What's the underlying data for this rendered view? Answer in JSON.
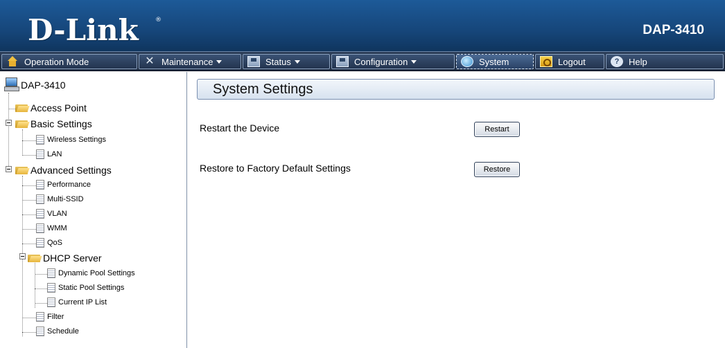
{
  "header": {
    "logo": "D-Link",
    "logo_mark": "®",
    "model": "DAP-3410"
  },
  "menu": [
    {
      "label": "Operation Mode",
      "icon": "home-icon",
      "dropdown": false
    },
    {
      "label": "Maintenance",
      "icon": "tools-icon",
      "dropdown": true
    },
    {
      "label": "Status",
      "icon": "disk-icon",
      "dropdown": true
    },
    {
      "label": "Configuration",
      "icon": "disk-icon",
      "dropdown": true
    },
    {
      "label": "System",
      "icon": "globe-icon",
      "dropdown": false
    },
    {
      "label": "Logout",
      "icon": "key-icon",
      "dropdown": false
    },
    {
      "label": "Help",
      "icon": "help-icon",
      "dropdown": false
    }
  ],
  "help_glyph": "?",
  "tree": {
    "root": "DAP-3410",
    "access_point": "Access Point",
    "basic_settings": "Basic Settings",
    "wireless_settings": "Wireless Settings",
    "lan": "LAN",
    "advanced_settings": "Advanced Settings",
    "performance": "Performance",
    "multi_ssid": "Multi-SSID",
    "vlan": "VLAN",
    "wmm": "WMM",
    "qos": "QoS",
    "dhcp_server": "DHCP Server",
    "dynamic_pool": "Dynamic Pool Settings",
    "static_pool": "Static Pool Settings",
    "current_ip": "Current IP List",
    "filter": "Filter",
    "schedule": "Schedule"
  },
  "content": {
    "title": "System Settings",
    "restart_label": "Restart the Device",
    "restart_button": "Restart",
    "restore_label": "Restore to Factory Default Settings",
    "restore_button": "Restore"
  },
  "colors": {
    "header": "#1d5a98",
    "menubar": "#2d3f5a",
    "title_bar": "#d7e2ef"
  }
}
